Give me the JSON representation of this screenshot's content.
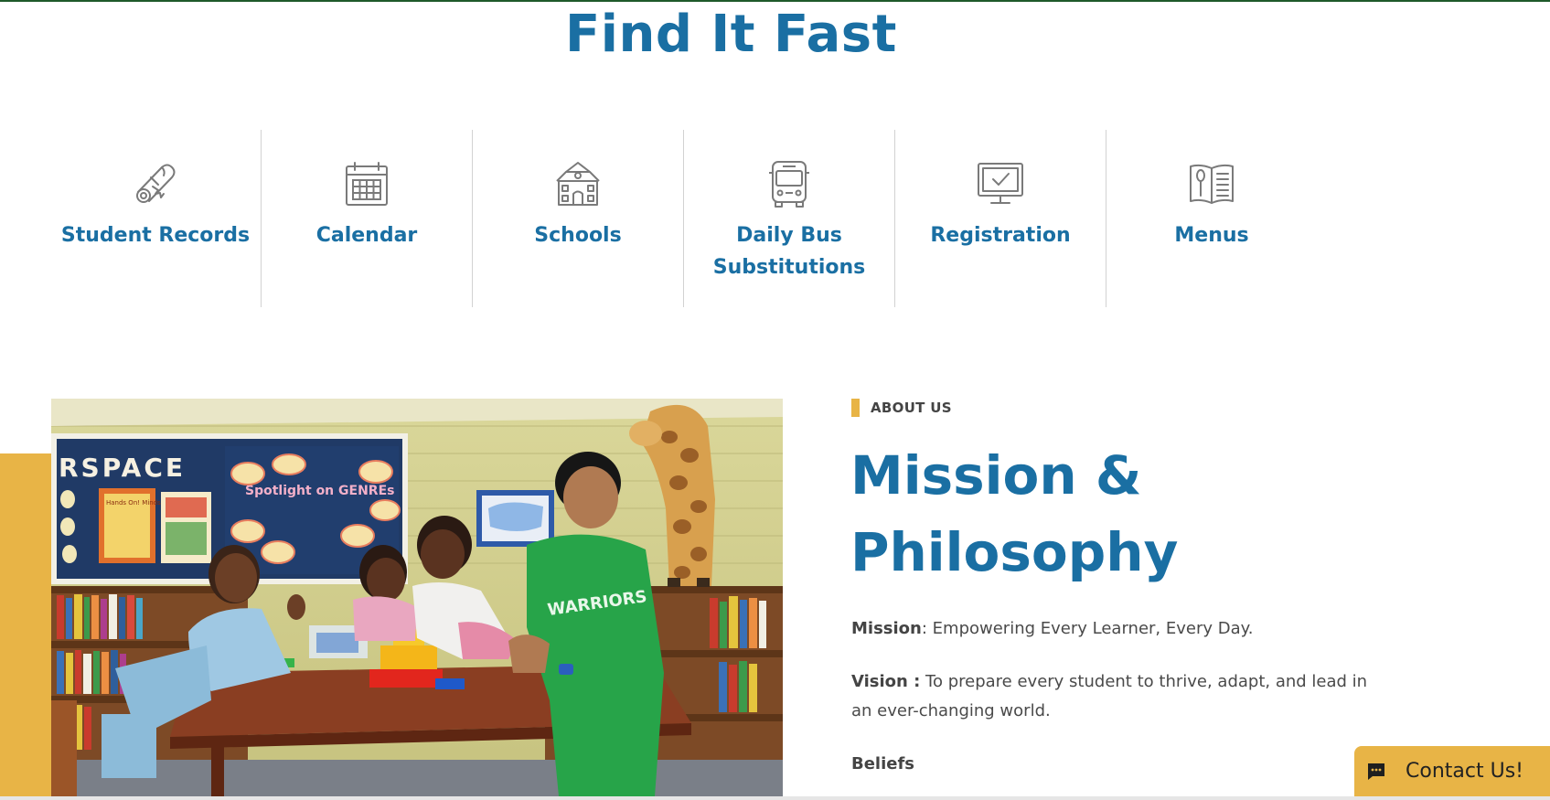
{
  "find_it_fast": {
    "title": "Find It Fast",
    "items": [
      {
        "label": "Student Records",
        "icon": "diploma-icon"
      },
      {
        "label": "Calendar",
        "icon": "calendar-icon"
      },
      {
        "label": "Schools",
        "icon": "school-building-icon"
      },
      {
        "label": "Daily Bus Substitutions",
        "icon": "bus-icon"
      },
      {
        "label": "Registration",
        "icon": "computer-monitor-check-icon"
      },
      {
        "label": "Menus",
        "icon": "menu-book-spoon-icon"
      }
    ]
  },
  "about": {
    "eyebrow": "ABOUT US",
    "heading": "Mission & Philosophy",
    "mission_label": "Mission",
    "mission_text": ": Empowering Every Learner, Every Day.",
    "vision_label": "Vision :",
    "vision_text": " To prepare every student to thrive, adapt, and lead in an ever-changing world.",
    "beliefs_label": "Beliefs"
  },
  "photo": {
    "bulletin_banner_text": "RSPACE",
    "spotlight_text": "Spotlight on GENREs",
    "poster_text": "Hands On! Minds On!",
    "shirt_text": "WARRIORS"
  },
  "contact": {
    "label": "Contact Us!",
    "icon": "chat-bubble-icon"
  },
  "colors": {
    "primary_blue": "#1a6fa3",
    "accent_gold": "#e8b446",
    "body_text": "#4a4a4a",
    "icon_gray": "#7a7a7a",
    "divider": "#d2d2d2"
  }
}
